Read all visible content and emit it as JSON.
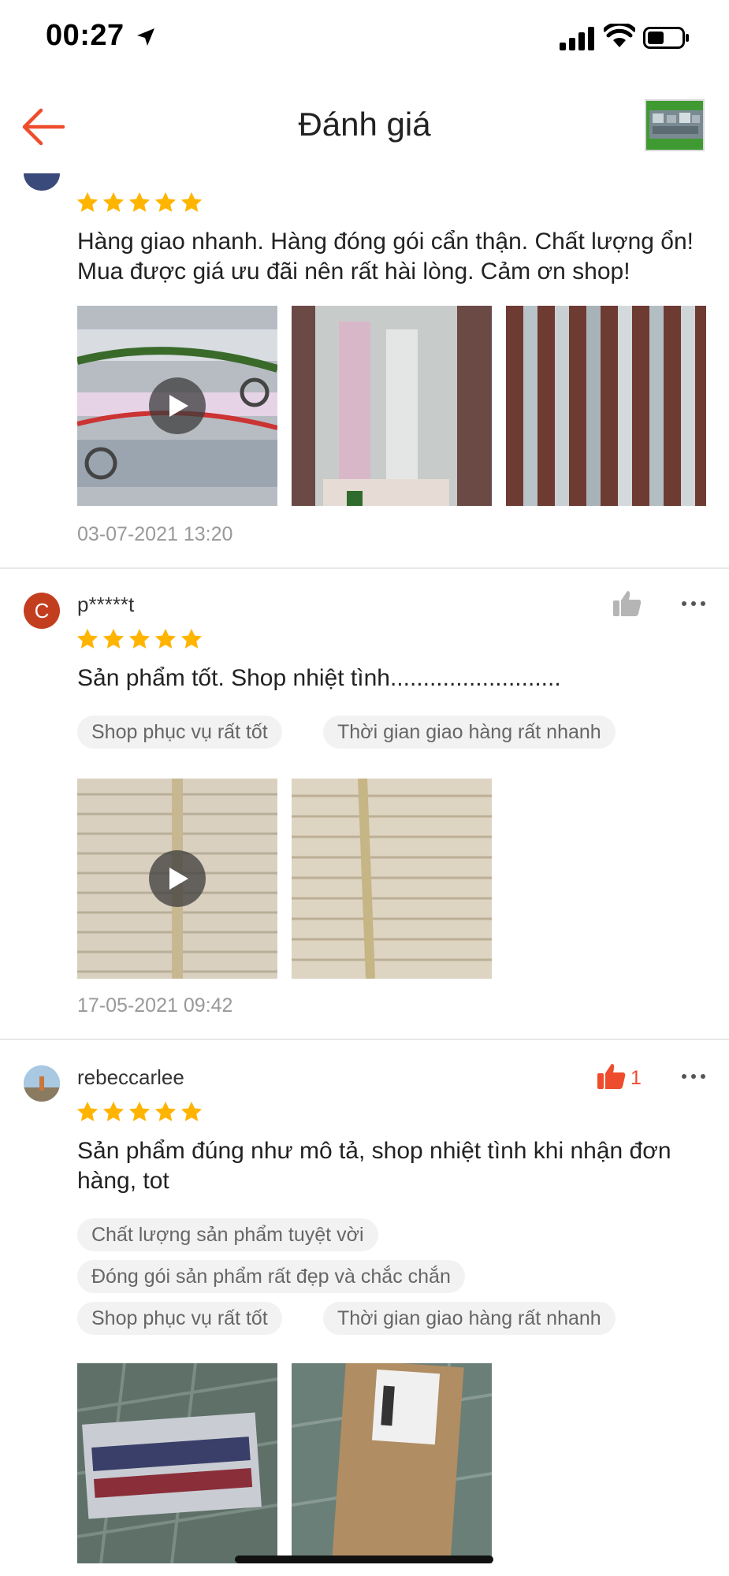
{
  "status_bar": {
    "time": "00:27"
  },
  "header": {
    "title": "Đánh giá"
  },
  "colors": {
    "accent": "#ee4d2d",
    "star": "#ffb400",
    "tag_bg": "#f2f2f2"
  },
  "icons": {
    "back": "arrow-left-icon",
    "location": "location-arrow-icon",
    "signal": "cellular-signal-icon",
    "wifi": "wifi-icon",
    "battery": "battery-icon",
    "like": "thumbs-up-icon",
    "more": "more-dots-icon",
    "play": "play-icon",
    "star": "star-icon"
  },
  "reviews": [
    {
      "username": "",
      "rating": 5,
      "comment": "Hàng giao nhanh. Hàng đóng gói cẩn thận. Chất lượng ổn! Mua được giá ưu đãi nên rất hài lòng. Cảm ơn shop!",
      "tags": [],
      "media": [
        "video",
        "image",
        "image"
      ],
      "date": "03-07-2021 13:20",
      "likes": ""
    },
    {
      "username": "p*****t",
      "avatar_letter": "C",
      "rating": 5,
      "comment": "Sản phẩm tốt. Shop nhiệt tình..........................",
      "tags": [
        "Shop phục vụ rất tốt",
        "Thời gian giao hàng rất nhanh"
      ],
      "media": [
        "video",
        "image"
      ],
      "date": "17-05-2021 09:42",
      "likes": ""
    },
    {
      "username": "rebeccarlee",
      "rating": 5,
      "comment": "Sản phẩm đúng như mô tả,  shop nhiệt tình khi nhận đơn hàng,  tot",
      "tags": [
        "Chất lượng sản phẩm tuyệt vời",
        "Đóng gói sản phẩm rất đẹp và chắc chắn",
        "Shop phục vụ rất tốt",
        "Thời gian giao hàng rất nhanh"
      ],
      "media": [
        "image",
        "image"
      ],
      "date": "",
      "likes": "1"
    }
  ]
}
